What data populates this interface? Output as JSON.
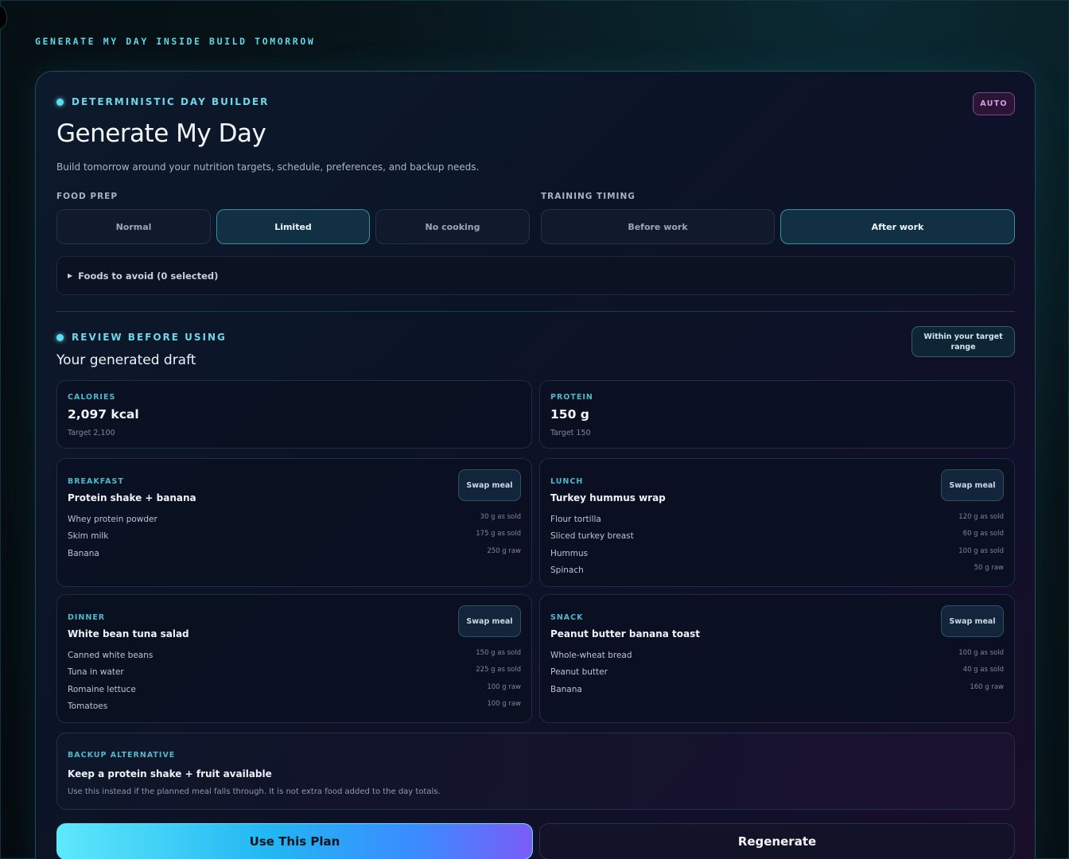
{
  "page": {
    "eyebrow": "GENERATE MY DAY INSIDE BUILD TOMORROW"
  },
  "builder": {
    "eyebrow": "DETERMINISTIC DAY BUILDER",
    "badge": "AUTO",
    "title": "Generate My Day",
    "subtitle": "Build tomorrow around your nutrition targets, schedule, preferences, and backup needs."
  },
  "food_prep": {
    "label": "FOOD PREP",
    "options": [
      {
        "label": "Normal",
        "selected": false
      },
      {
        "label": "Limited",
        "selected": true
      },
      {
        "label": "No cooking",
        "selected": false
      }
    ]
  },
  "training_timing": {
    "label": "TRAINING TIMING",
    "options": [
      {
        "label": "Before work",
        "selected": false
      },
      {
        "label": "After work",
        "selected": true
      }
    ]
  },
  "foods_to_avoid": {
    "label": "Foods to avoid (0 selected)"
  },
  "review": {
    "eyebrow": "REVIEW BEFORE USING",
    "title": "Your generated draft",
    "status_badge": "Within your target range"
  },
  "stats": [
    {
      "label": "CALORIES",
      "value": "2,097 kcal",
      "target": "Target 2,100"
    },
    {
      "label": "PROTEIN",
      "value": "150 g",
      "target": "Target 150"
    }
  ],
  "meals": [
    {
      "label": "BREAKFAST",
      "name": "Protein shake + banana",
      "swap_label": "Swap meal",
      "items": [
        {
          "name": "Whey protein powder",
          "qty": "30 g as sold"
        },
        {
          "name": "Skim milk",
          "qty": "175 g as sold"
        },
        {
          "name": "Banana",
          "qty": "250 g raw"
        }
      ]
    },
    {
      "label": "LUNCH",
      "name": "Turkey hummus wrap",
      "swap_label": "Swap meal",
      "items": [
        {
          "name": "Flour tortilla",
          "qty": "120 g as sold"
        },
        {
          "name": "Sliced turkey breast",
          "qty": "60 g as sold"
        },
        {
          "name": "Hummus",
          "qty": "100 g as sold"
        },
        {
          "name": "Spinach",
          "qty": "50 g raw"
        }
      ]
    },
    {
      "label": "DINNER",
      "name": "White bean tuna salad",
      "swap_label": "Swap meal",
      "items": [
        {
          "name": "Canned white beans",
          "qty": "150 g as sold"
        },
        {
          "name": "Tuna in water",
          "qty": "225 g as sold"
        },
        {
          "name": "Romaine lettuce",
          "qty": "100 g raw"
        },
        {
          "name": "Tomatoes",
          "qty": "100 g raw"
        }
      ]
    },
    {
      "label": "SNACK",
      "name": "Peanut butter banana toast",
      "swap_label": "Swap meal",
      "items": [
        {
          "name": "Whole-wheat bread",
          "qty": "100 g as sold"
        },
        {
          "name": "Peanut butter",
          "qty": "40 g as sold"
        },
        {
          "name": "Banana",
          "qty": "160 g raw"
        }
      ]
    }
  ],
  "backup": {
    "label": "BACKUP ALTERNATIVE",
    "title": "Keep a protein shake + fruit available",
    "note": "Use this instead if the planned meal falls through. It is not extra food added to the day totals."
  },
  "actions": {
    "primary": "Use This Plan",
    "secondary": "Regenerate"
  }
}
